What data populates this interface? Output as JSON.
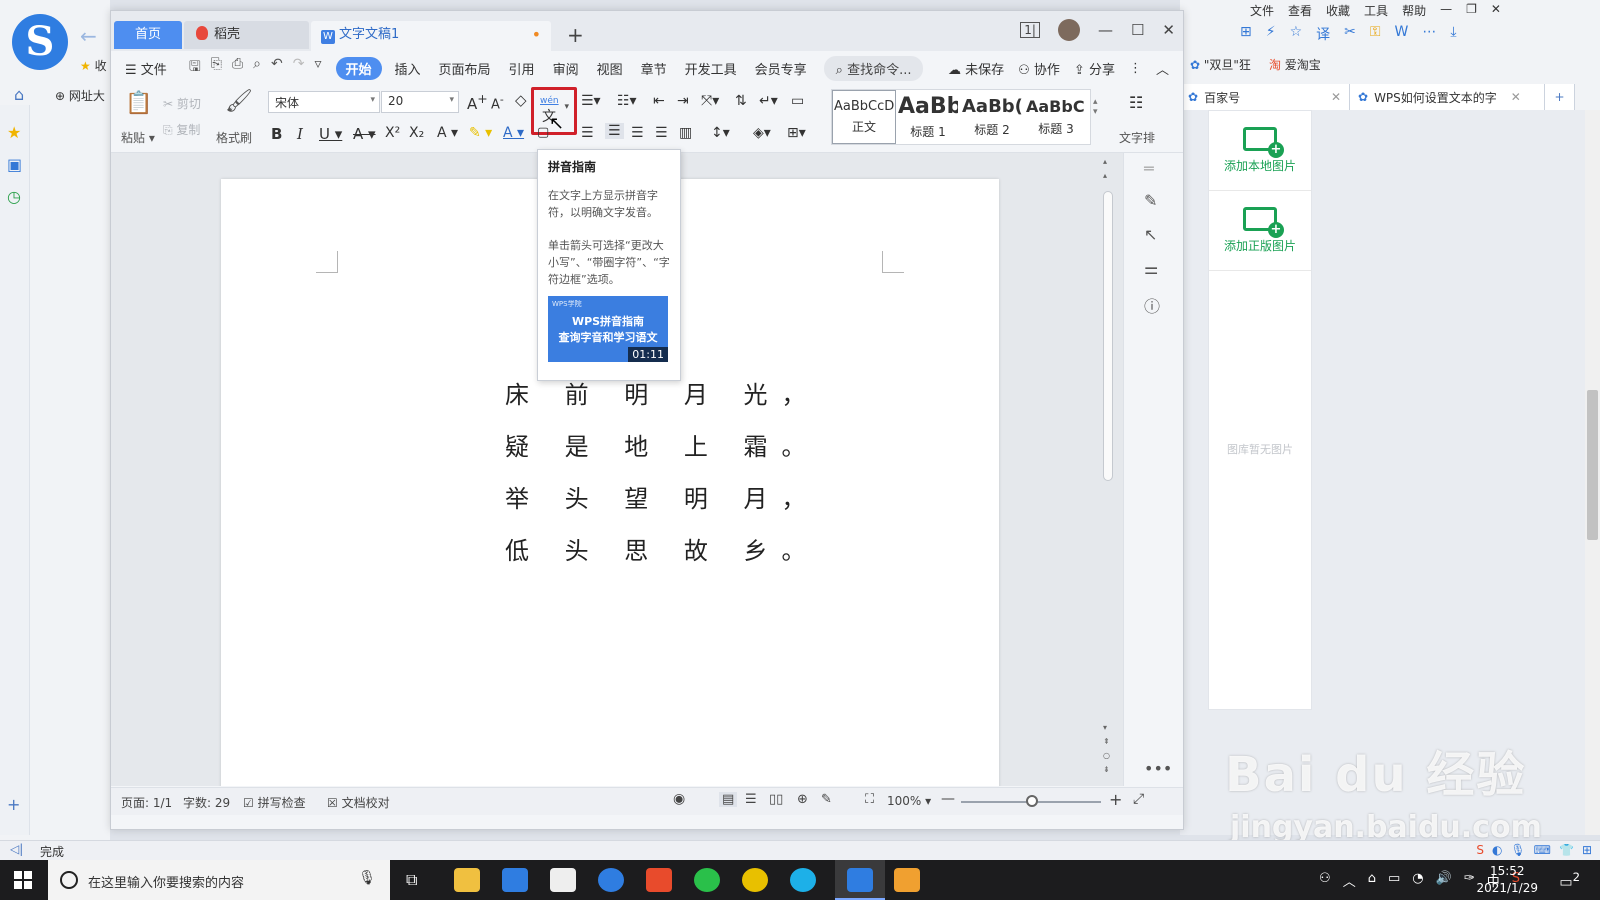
{
  "browser": {
    "favorites_label": "收",
    "site_label": "网址大",
    "menu": [
      "文件",
      "查看",
      "收藏",
      "工具",
      "帮助"
    ],
    "bookmarks": [
      "\"双旦\"狂",
      "爱淘宝"
    ],
    "tabs": [
      {
        "label": "百家号"
      },
      {
        "label": "WPS如何设置文本的字"
      }
    ],
    "status": "完成",
    "watermark": "Bai du 经验",
    "watermark_url": "jingyan.baidu.com"
  },
  "wps": {
    "tabs": {
      "home": "首页",
      "daoke": "稻壳",
      "doc": "文字文稿1"
    },
    "menu": {
      "file": "文件",
      "items": [
        "开始",
        "插入",
        "页面布局",
        "引用",
        "审阅",
        "视图",
        "章节",
        "开发工具",
        "会员专享"
      ],
      "active": "开始",
      "search": "查找命令...",
      "unsaved": "未保存",
      "collab": "协作",
      "share": "分享"
    },
    "ribbon": {
      "paste": "粘贴",
      "cut": "剪切",
      "copy": "复制",
      "format_painter": "格式刷",
      "font_name": "宋体",
      "font_size": "20",
      "pinyin_wen": "wén",
      "pinyin_char": "文",
      "text_tool": "文字排",
      "styles": [
        {
          "sample": "AaBbCcDd",
          "label": "正文"
        },
        {
          "sample": "AaBb",
          "label": "标题 1"
        },
        {
          "sample": "AaBb(",
          "label": "标题 2"
        },
        {
          "sample": "AaBbC(",
          "label": "标题 3"
        }
      ]
    },
    "tooltip": {
      "title": "拼音指南",
      "text1": "在文字上方显示拼音字符，以明确文字发音。",
      "text2": "单击箭头可选择“更改大小写”、“带圈字符”、“字符边框”选项。",
      "video_title": "WPS拼音指南\n查询字音和学习语文",
      "video_time": "01:11",
      "video_logo": "WPS学院"
    },
    "poem": [
      "床 前 明 月 光，",
      "疑 是 地 上 霜。",
      "举 头 望 明 月，",
      "低 头 思 故 乡。"
    ],
    "poem_visible": [
      "床 前 明 月 光，",
      "疑 是 地 上 霜。",
      "举 头 望 明 月，",
      "低 头 思 故 乡。"
    ],
    "status": {
      "page": "页面: 1/1",
      "words": "字数: 29",
      "spell": "拼写检查",
      "proof": "文档校对",
      "zoom": "100%"
    }
  },
  "image_panel": {
    "add_local": "添加本地图片",
    "add_licensed": "添加正版图片",
    "empty": "图库暂无图片"
  },
  "taskbar": {
    "search_placeholder": "在这里输入你要搜索的内容",
    "ime": "中",
    "time": "15:52",
    "date": "2021/1/29",
    "notify_count": "2"
  },
  "colors": {
    "accent": "#4e8ef0",
    "highlight_box": "#d0202a",
    "image_green": "#1aa154"
  }
}
